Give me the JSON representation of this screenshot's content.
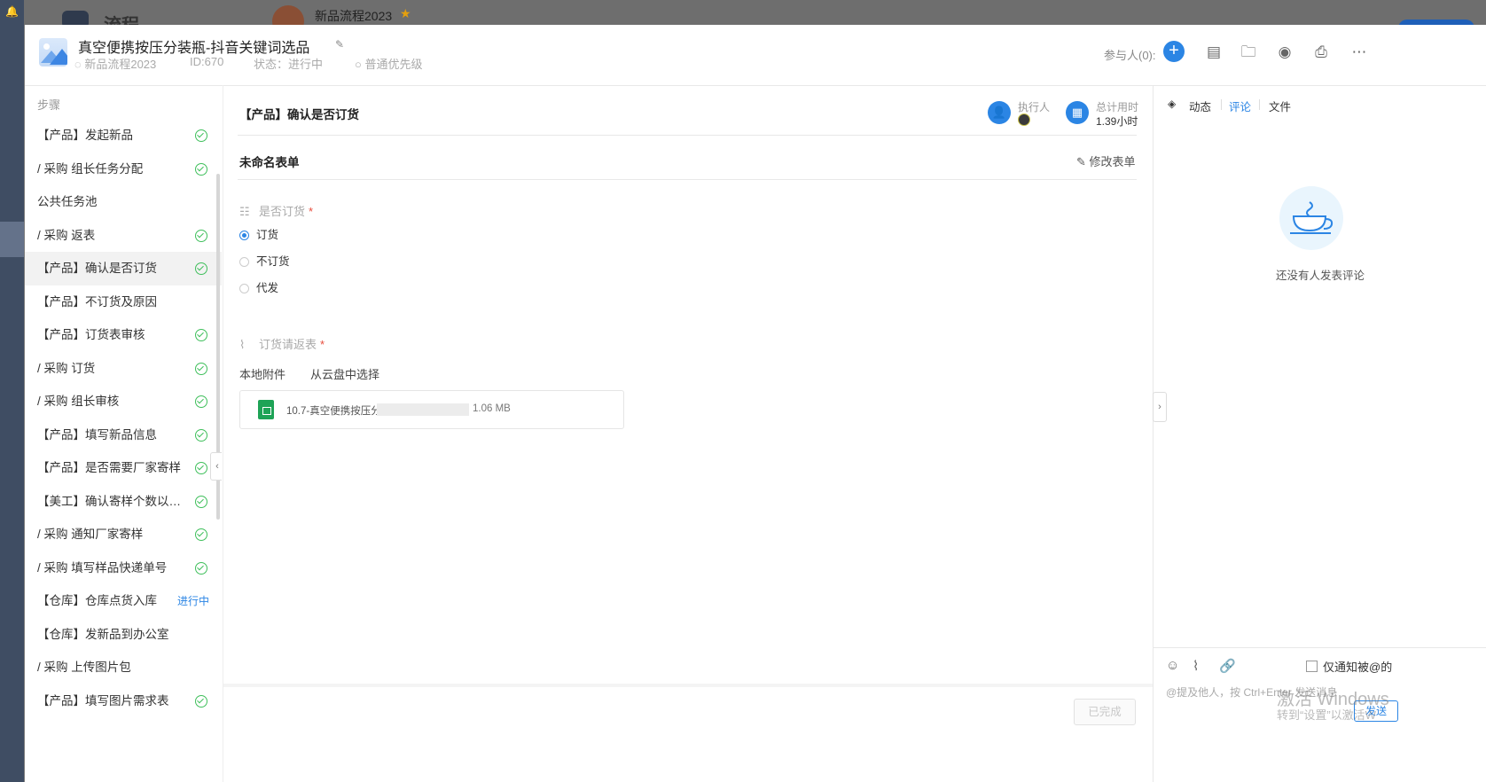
{
  "background": {
    "app_title": "流程",
    "process_name": "新品流程2023"
  },
  "header": {
    "title": "真空便携按压分装瓶-抖音关键词选品",
    "process": "新品流程2023",
    "id": "ID:670",
    "status": "状态：进行中",
    "priority": "普通优先级",
    "participants": "参与人(0):"
  },
  "steps": {
    "heading": "步骤",
    "items": [
      {
        "label": "【产品】发起新品",
        "done": true
      },
      {
        "label": "/ 采购 组长任务分配",
        "done": true
      },
      {
        "label": "公共任务池",
        "done": false
      },
      {
        "label": "/ 采购 返表",
        "done": true
      },
      {
        "label": "【产品】确认是否订货",
        "done": true,
        "selected": true
      },
      {
        "label": "【产品】不订货及原因",
        "done": false
      },
      {
        "label": "【产品】订货表审核",
        "done": true
      },
      {
        "label": "/ 采购 订货",
        "done": true
      },
      {
        "label": "/ 采购 组长审核",
        "done": true
      },
      {
        "label": "【产品】填写新品信息",
        "done": true
      },
      {
        "label": "【产品】是否需要厂家寄样",
        "done": true
      },
      {
        "label": "【美工】确认寄样个数以及图片需求",
        "done": true
      },
      {
        "label": "/ 采购 通知厂家寄样",
        "done": true
      },
      {
        "label": "/ 采购 填写样品快递单号",
        "done": true
      },
      {
        "label": "【仓库】仓库点货入库",
        "done": false,
        "status": "进行中"
      },
      {
        "label": "【仓库】发新品到办公室",
        "done": false
      },
      {
        "label": "/ 采购 上传图片包",
        "done": false
      },
      {
        "label": "【产品】填写图片需求表",
        "done": true
      }
    ]
  },
  "task": {
    "title": "【产品】确认是否订货",
    "executor_label": "执行人",
    "time_label": "总计用时",
    "time_value": "1.39小时",
    "form_name": "未命名表单",
    "modify_form": "修改表单",
    "order_question": "是否订货",
    "options": [
      "订货",
      "不订货",
      "代发"
    ],
    "selected_option": "订货",
    "attach_label": "订货请返表",
    "local_attach": "本地附件",
    "cloud_attach": "从云盘中选择",
    "file_name": "10.7-真空便携按压分",
    "file_size": "1.06 MB",
    "done_button": "已完成"
  },
  "panel": {
    "tabs": [
      "动态",
      "评论",
      "文件"
    ],
    "active_tab": "评论",
    "empty_text": "还没有人发表评论",
    "only_notify": "仅通知被@的",
    "placeholder": "@提及他人，按 Ctrl+Enter 发送消息",
    "send": "发送"
  },
  "watermark": {
    "line1": "激活 Windows",
    "line2": "转到“设置”以激活W"
  },
  "colors": {
    "accent": "#2b85e4",
    "success": "#3fbf5b",
    "sheet": "#1ea356"
  }
}
